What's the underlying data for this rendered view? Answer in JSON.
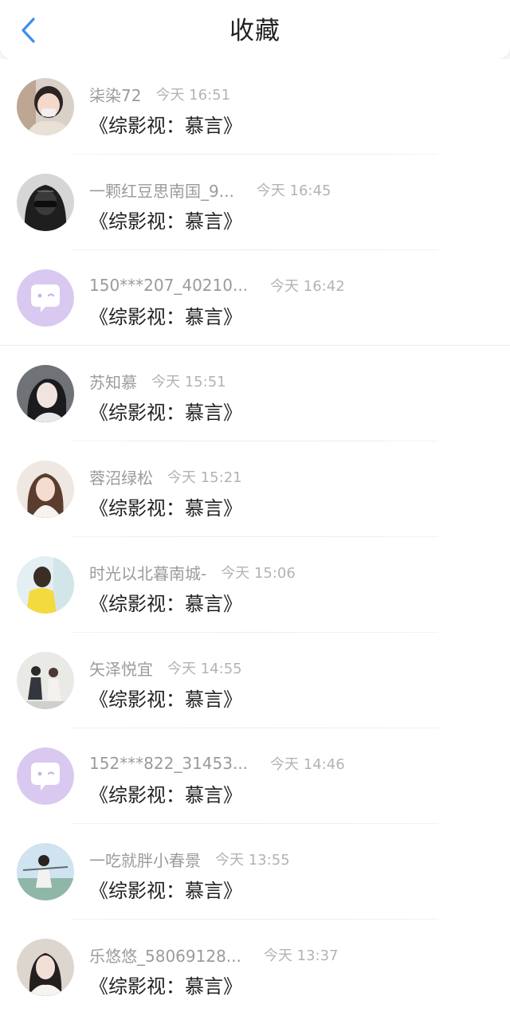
{
  "header": {
    "title": "收藏"
  },
  "items": [
    {
      "username": "柒染72",
      "time": "今天 16:51",
      "content": "《综影视：慕言》",
      "avatar": "photo-avatar"
    },
    {
      "username": "一颗红豆思南国_9...",
      "time": "今天 16:45",
      "content": "《综影视：慕言》",
      "avatar": "photo-avatar"
    },
    {
      "username": "150***207_40210...",
      "time": "今天 16:42",
      "content": "《综影视：慕言》",
      "avatar": "default-chat-avatar-icon"
    },
    {
      "username": "苏知慕",
      "time": "今天 15:51",
      "content": "《综影视：慕言》",
      "avatar": "photo-avatar"
    },
    {
      "username": "蓉沼绿松",
      "time": "今天 15:21",
      "content": "《综影视：慕言》",
      "avatar": "photo-avatar"
    },
    {
      "username": "时光以北暮南城-",
      "time": "今天 15:06",
      "content": "《综影视：慕言》",
      "avatar": "photo-avatar"
    },
    {
      "username": "矢泽悦宜",
      "time": "今天 14:55",
      "content": "《综影视：慕言》",
      "avatar": "photo-avatar"
    },
    {
      "username": "152***822_31453...",
      "time": "今天 14:46",
      "content": "《综影视：慕言》",
      "avatar": "default-chat-avatar-icon"
    },
    {
      "username": "一吃就胖小春景",
      "time": "今天 13:55",
      "content": "《综影视：慕言》",
      "avatar": "photo-avatar"
    },
    {
      "username": "乐悠悠_58069128...",
      "time": "今天 13:37",
      "content": "《综影视：慕言》",
      "avatar": "photo-avatar"
    }
  ],
  "colors": {
    "accent": "#3b8ef0",
    "default_avatar": "#d9c9f1"
  }
}
